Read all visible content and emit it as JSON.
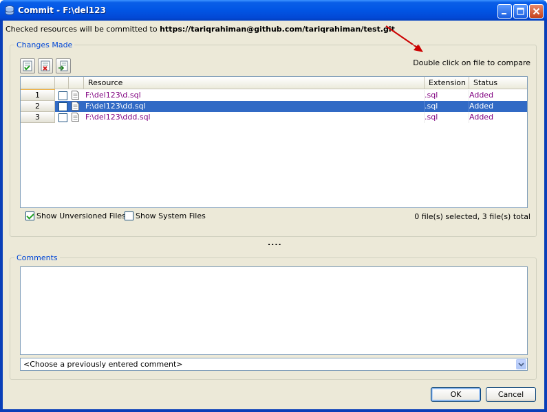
{
  "window": {
    "title": "Commit - F:\\del123"
  },
  "info": {
    "prefix": "Checked resources will be committed to ",
    "url": "https://tariqrahiman@github.com/tariqrahiman/test.git"
  },
  "changes": {
    "legend": "Changes Made",
    "hint": "Double click on file to compare",
    "toolbar": [
      "check-all-icon",
      "uncheck-all-icon",
      "refresh-icon"
    ],
    "columns": {
      "resource": "Resource",
      "extension": "Extension",
      "status": "Status"
    },
    "rows": [
      {
        "num": "1",
        "resource": "F:\\del123\\d.sql",
        "extension": ".sql",
        "status": "Added",
        "selected": false
      },
      {
        "num": "2",
        "resource": "F:\\del123\\dd.sql",
        "extension": ".sql",
        "status": "Added",
        "selected": true
      },
      {
        "num": "3",
        "resource": "F:\\del123\\ddd.sql",
        "extension": ".sql",
        "status": "Added",
        "selected": false
      }
    ],
    "show_unversioned": {
      "label": "Show Unversioned Files",
      "checked": true
    },
    "show_system": {
      "label": "Show System Files",
      "checked": false
    },
    "summary": "0 file(s) selected, 3 file(s) total"
  },
  "splitter": "....",
  "comments": {
    "legend": "Comments",
    "value": "",
    "combo_text": "<Choose a previously entered comment>"
  },
  "buttons": {
    "ok": "OK",
    "cancel": "Cancel"
  },
  "colors": {
    "selection": "#316ac5",
    "file_text": "#800080",
    "legend": "#0046d5",
    "arrow": "#cc0000"
  }
}
